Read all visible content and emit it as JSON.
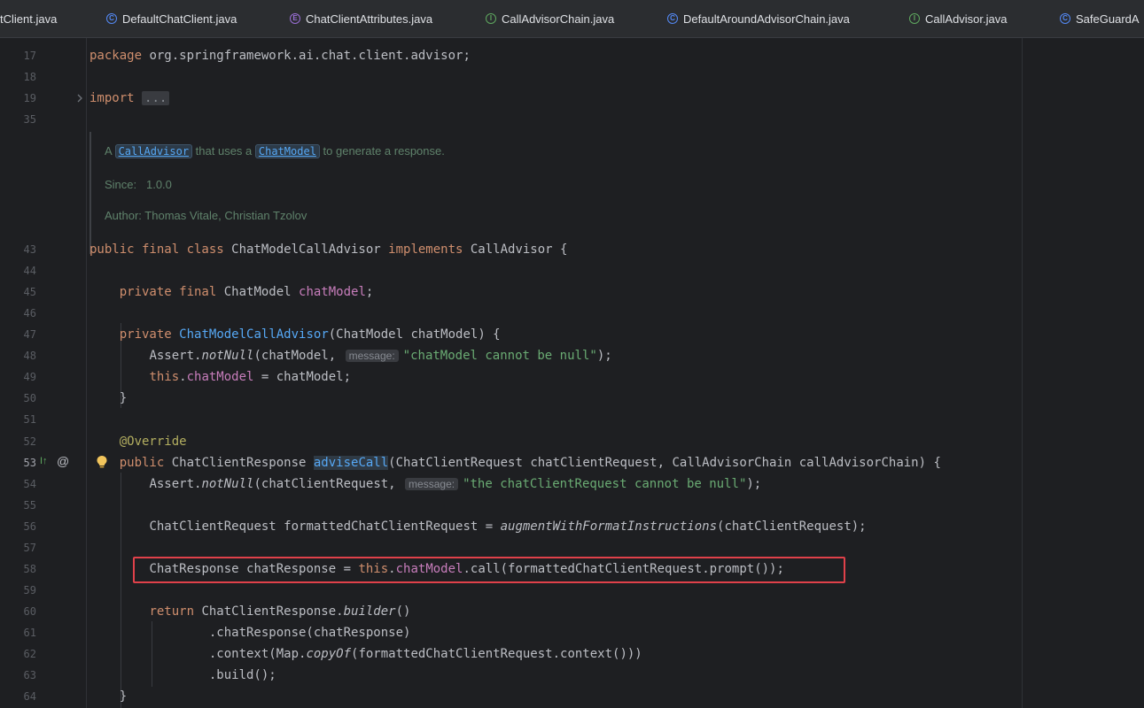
{
  "tabs": [
    {
      "label": "tClient.java",
      "icon": ""
    },
    {
      "label": "DefaultChatClient.java",
      "icon": "class-icon",
      "badge": "C"
    },
    {
      "label": "ChatClientAttributes.java",
      "icon": "enum-icon",
      "badge": "E"
    },
    {
      "label": "CallAdvisorChain.java",
      "icon": "interface-icon",
      "badge": "I"
    },
    {
      "label": "DefaultAroundAdvisorChain.java",
      "icon": "class-icon",
      "badge": "C"
    },
    {
      "label": "CallAdvisor.java",
      "icon": "interface-icon",
      "badge": "I"
    },
    {
      "label": "SafeGuardA",
      "icon": "class-icon",
      "badge": "C"
    }
  ],
  "line_numbers": [
    "17",
    "18",
    "19",
    "35",
    "43",
    "44",
    "45",
    "46",
    "47",
    "48",
    "49",
    "50",
    "51",
    "52",
    "53",
    "54",
    "55",
    "56",
    "57",
    "58",
    "59",
    "60",
    "61",
    "62",
    "63",
    "64"
  ],
  "gutter": {
    "implements_marker": "I↑",
    "override_marker": "@"
  },
  "code": {
    "package_kw": "package",
    "package_name": " org.springframework.ai.chat.client.advisor;",
    "import_kw": "import",
    "import_folded": "...",
    "class_decl_kw": "public final class",
    "class_name": " ChatModelCallAdvisor ",
    "implements_kw": "implements",
    "class_decl_tail": " CallAdvisor {",
    "field_kw": "private final",
    "field_type": " ChatModel ",
    "field_name": "chatModel",
    "semicolon": ";",
    "ctor_kw": "private",
    "ctor_name": "ChatModelCallAdvisor",
    "ctor_params": "(ChatModel chatModel) {",
    "assert_prefix": "Assert.",
    "assert_method": "notNull",
    "assert1_args": "(chatModel, ",
    "hint_message": "message:",
    "assert1_msg": "\"chatModel cannot be null\"",
    "assert_close": ");",
    "this_kw": "this",
    "assign_tail": " = chatModel;",
    "close_brace": "}",
    "override": "@Override",
    "method_kw": "public",
    "method_return": " ChatClientResponse ",
    "method_name": "adviseCall",
    "method_params": "(ChatClientRequest chatClientRequest, CallAdvisorChain callAdvisorChain) {",
    "assert2_args": "(chatClientRequest, ",
    "assert2_msg": "\"the chatClientRequest cannot be null\"",
    "formatted_decl": "ChatClientRequest formattedChatClientRequest = ",
    "augment_call": "augmentWithFormatInstructions",
    "augment_args": "(chatClientRequest);",
    "response_decl": "ChatResponse chatResponse = ",
    "call_tail": ".call(formattedChatClientRequest.prompt());",
    "return_kw": "return",
    "builder_prefix": " ChatClientResponse.",
    "builder_method": "builder",
    "parens": "()",
    "chain1": ".chatResponse(chatResponse)",
    "chain2_prefix": ".context(Map.",
    "copyof": "copyOf",
    "chain2_tail": "(formattedChatClientRequest.context()))",
    "chain3": ".build();"
  },
  "javadoc": {
    "line1_a": "A ",
    "link1": "CallAdvisor",
    "line1_b": " that uses a ",
    "link2": "ChatModel",
    "line1_c": " to generate a response.",
    "since_label": "Since:",
    "since_value": "1.0.0",
    "author": "Author: Thomas Vitale, Christian Tzolov"
  },
  "colors": {
    "background": "#1e1f22",
    "keyword": "#cf8e6d",
    "field": "#c77dbb",
    "string": "#6aab73",
    "annotation": "#b3ae60",
    "method_decl": "#56a8f5",
    "highlight_box": "#e0414a"
  }
}
